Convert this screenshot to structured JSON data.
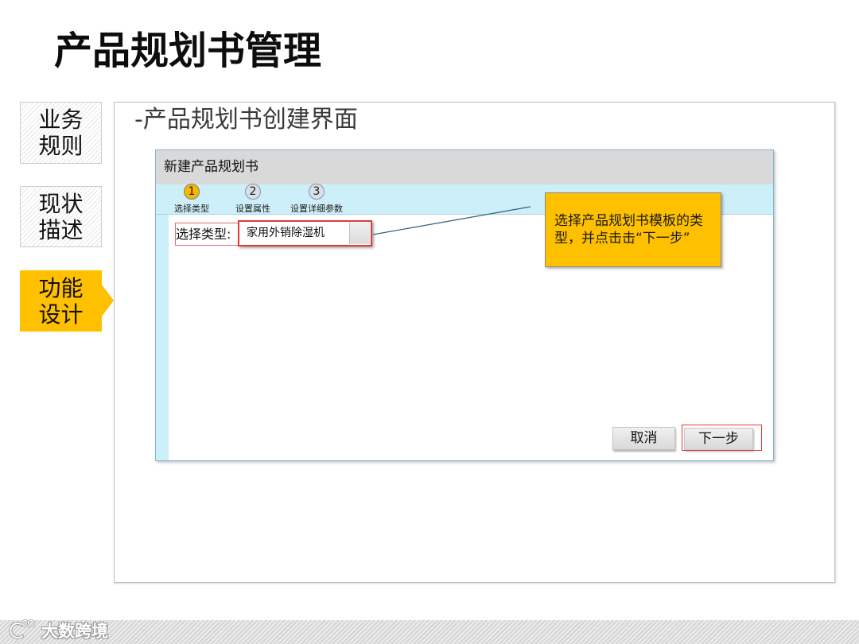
{
  "slide": {
    "title": "产品规划书管理"
  },
  "nav": {
    "items": [
      {
        "label": "业务规则",
        "active": false
      },
      {
        "label": "现状描述",
        "active": false
      },
      {
        "label": "功能设计",
        "active": true
      }
    ]
  },
  "panel": {
    "heading": "-产品规划书创建界面"
  },
  "dialog": {
    "title": "新建产品规划书",
    "steps": [
      {
        "number": "1",
        "label": "选择类型",
        "active": true
      },
      {
        "number": "2",
        "label": "设置属性",
        "active": false
      },
      {
        "number": "3",
        "label": "设置详细参数",
        "active": false
      }
    ],
    "type_field": {
      "label": "选择类型:",
      "value": "家用外销除湿机"
    },
    "buttons": {
      "cancel": "取消",
      "next": "下一步"
    }
  },
  "callout": {
    "text": "选择产品规划书模板的类型，并点击击“下一步”"
  },
  "footer": {
    "logo_text": "大数跨境",
    "logo_icon": "brand-logo-icon"
  },
  "colors": {
    "accent": "#FFC000",
    "step-active": "#F5B800",
    "steps-bar": "#CDEFF9",
    "titlebar": "#D9D9D9",
    "highlight": "#E03C3C",
    "dialog-border": "#86B4CF"
  }
}
